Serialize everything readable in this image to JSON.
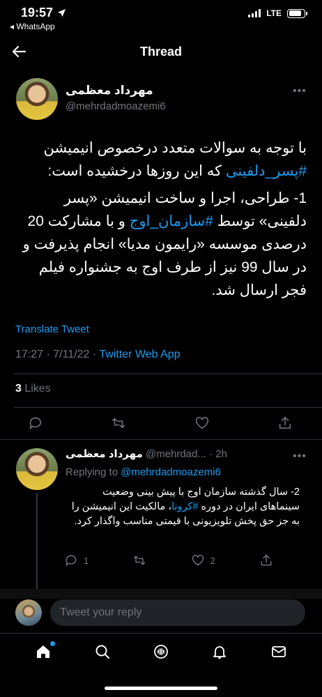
{
  "status_bar": {
    "time": "19:57",
    "back_app": "◂ WhatsApp",
    "network": "LTE",
    "battery_level": 0.85
  },
  "header": {
    "title": "Thread"
  },
  "main_tweet": {
    "display_name": "مهرداد معظمی",
    "handle": "@mehrdadmoazemi6",
    "text_line1": "با توجه به سوالات متعدد درخصوص انیمیشن",
    "hashtag1": "#پسر_دلفینی",
    "text_line2_rest": " که این روزها درخشیده است:",
    "text_para2_a": "1- طراحی، اجرا و ساخت انیمیشن «پسر دلفینی» توسط ",
    "hashtag2": "#سازمان_اوج",
    "text_para2_b": " و با مشارکت 20 درصدی موسسه «رایمون مدیا» انجام پذیرفت و در سال 99 نیز از طرف اوج به جشنواره فیلم فجر ارسال شد.",
    "translate_label": "Translate Tweet",
    "timestamp": "17:27 · 7/11/22 · ",
    "source_app": "Twitter Web App",
    "likes_count": "3",
    "likes_label": " Likes"
  },
  "reply_tweet": {
    "display_name": "مهرداد معظمی",
    "handle_time": " @mehrdad... · 2h",
    "replying_label": "Replying to ",
    "replying_to": "@mehrdadmoazemi6",
    "text_a": "2- سال گذشته سازمان اوج با پیش بینی وضعیت سینماهای ایران در دوره ",
    "hashtag": "#کرونا",
    "text_b": "، مالکیت این انیمیشن را به جز حق پخش تلویزیونی با قیمتی مناسب واگذار کرد.",
    "reply_count": "1",
    "like_count": "2"
  },
  "compose": {
    "placeholder": "Tweet your reply"
  },
  "tabbar": {
    "items": [
      "home-icon",
      "search-icon",
      "spaces-icon",
      "notifications-icon",
      "messages-icon"
    ]
  },
  "colors": {
    "accent": "#1d9bf0",
    "muted": "#71767b",
    "background": "#000000"
  }
}
